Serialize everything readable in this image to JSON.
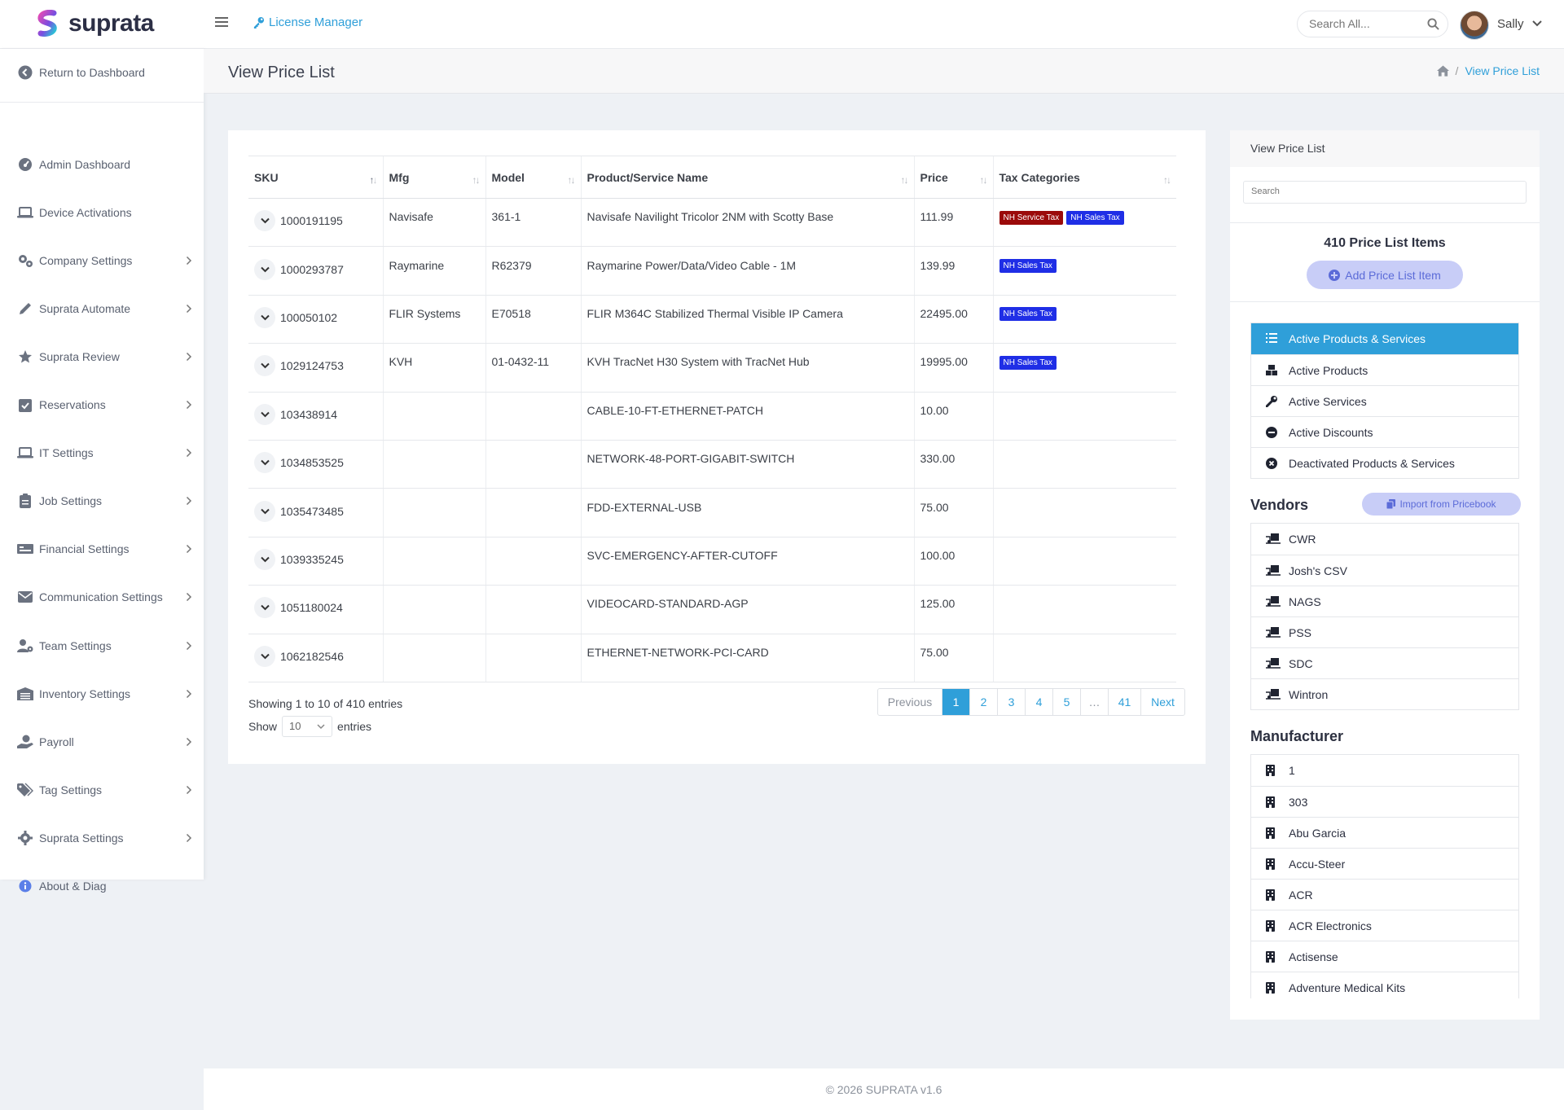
{
  "app": {
    "name": "suprata"
  },
  "topbar": {
    "module_label": "License Manager",
    "search_placeholder": "Search All...",
    "user_name": "Sally"
  },
  "sidebar": {
    "return_label": "Return to Dashboard",
    "items": [
      {
        "label": "Admin Dashboard",
        "icon": "gauge-icon",
        "has_children": false
      },
      {
        "label": "Device Activations",
        "icon": "laptop-icon",
        "has_children": false
      },
      {
        "label": "Company Settings",
        "icon": "gears-icon",
        "has_children": true
      },
      {
        "label": "Suprata Automate",
        "icon": "pencil-icon",
        "has_children": true
      },
      {
        "label": "Suprata Review",
        "icon": "star-icon",
        "has_children": true
      },
      {
        "label": "Reservations",
        "icon": "calendar-check-icon",
        "has_children": true
      },
      {
        "label": "IT Settings",
        "icon": "laptop-icon",
        "has_children": true
      },
      {
        "label": "Job Settings",
        "icon": "clipboard-icon",
        "has_children": true
      },
      {
        "label": "Financial Settings",
        "icon": "money-check-icon",
        "has_children": true
      },
      {
        "label": "Communication Settings",
        "icon": "envelope-icon",
        "has_children": true
      },
      {
        "label": "Team Settings",
        "icon": "user-gear-icon",
        "has_children": true
      },
      {
        "label": "Inventory Settings",
        "icon": "warehouse-icon",
        "has_children": true
      },
      {
        "label": "Payroll",
        "icon": "hand-dollar-icon",
        "has_children": true
      },
      {
        "label": "Tag Settings",
        "icon": "tags-icon",
        "has_children": true
      },
      {
        "label": "Suprata Settings",
        "icon": "gear-icon",
        "has_children": true
      },
      {
        "label": "About & Diag",
        "icon": "info-circle-icon",
        "has_children": false
      }
    ]
  },
  "page": {
    "title": "View Price List",
    "breadcrumb_current": "View Price List"
  },
  "table": {
    "columns": [
      "SKU",
      "Mfg",
      "Model",
      "Product/Service Name",
      "Price",
      "Tax Categories"
    ],
    "rows": [
      {
        "sku": "1000191195",
        "mfg": "Navisafe",
        "model": "361-1",
        "name": "Navisafe Navilight Tricolor 2NM with Scotty Base",
        "price": "111.99",
        "taxes": [
          "NH Service Tax",
          "NH Sales Tax"
        ]
      },
      {
        "sku": "1000293787",
        "mfg": "Raymarine",
        "model": "R62379",
        "name": "Raymarine Power/Data/Video Cable - 1M",
        "price": "139.99",
        "taxes": [
          "NH Sales Tax"
        ]
      },
      {
        "sku": "100050102",
        "mfg": "FLIR Systems",
        "model": "E70518",
        "name": "FLIR M364C Stabilized Thermal Visible IP Camera",
        "price": "22495.00",
        "taxes": [
          "NH Sales Tax"
        ]
      },
      {
        "sku": "1029124753",
        "mfg": "KVH",
        "model": "01-0432-11",
        "name": "KVH TracNet H30 System with TracNet Hub",
        "price": "19995.00",
        "taxes": [
          "NH Sales Tax"
        ]
      },
      {
        "sku": "103438914",
        "mfg": "",
        "model": "",
        "name": "CABLE-10-FT-ETHERNET-PATCH",
        "price": "10.00",
        "taxes": []
      },
      {
        "sku": "1034853525",
        "mfg": "",
        "model": "",
        "name": "NETWORK-48-PORT-GIGABIT-SWITCH",
        "price": "330.00",
        "taxes": []
      },
      {
        "sku": "1035473485",
        "mfg": "",
        "model": "",
        "name": "FDD-EXTERNAL-USB",
        "price": "75.00",
        "taxes": []
      },
      {
        "sku": "1039335245",
        "mfg": "",
        "model": "",
        "name": "SVC-EMERGENCY-AFTER-CUTOFF",
        "price": "100.00",
        "taxes": []
      },
      {
        "sku": "1051180024",
        "mfg": "",
        "model": "",
        "name": "VIDEOCARD-STANDARD-AGP",
        "price": "125.00",
        "taxes": []
      },
      {
        "sku": "1062182546",
        "mfg": "",
        "model": "",
        "name": "ETHERNET-NETWORK-PCI-CARD",
        "price": "75.00",
        "taxes": []
      }
    ],
    "tax_colors": {
      "NH Service Tax": "#9b0a0a",
      "NH Sales Tax": "#1f2ee6"
    },
    "info": "Showing 1 to 10 of 410 entries",
    "show_label": "Show",
    "page_size": "10",
    "entries_label": "entries",
    "pagination": [
      "Previous",
      "1",
      "2",
      "3",
      "4",
      "5",
      "…",
      "41",
      "Next"
    ],
    "current_page": "1"
  },
  "panel": {
    "title": "View Price List",
    "search_placeholder": "Search",
    "count_text": "410 Price List Items",
    "add_button": "Add Price List Item",
    "filters": [
      {
        "label": "Active Products & Services",
        "icon": "list-icon",
        "active": true
      },
      {
        "label": "Active Products",
        "icon": "boxes-icon",
        "active": false
      },
      {
        "label": "Active Services",
        "icon": "wrench-icon",
        "active": false
      },
      {
        "label": "Active Discounts",
        "icon": "minus-circle-icon",
        "active": false
      },
      {
        "label": "Deactivated Products & Services",
        "icon": "x-circle-icon",
        "active": false
      }
    ],
    "vendors_title": "Vendors",
    "import_button": "Import from Pricebook",
    "vendors": [
      "CWR",
      "Josh's CSV",
      "NAGS",
      "PSS",
      "SDC",
      "Wintron"
    ],
    "manufacturer_title": "Manufacturer",
    "manufacturers": [
      "1",
      "303",
      "Abu Garcia",
      "Accu-Steer",
      "ACR",
      "ACR Electronics",
      "Actisense",
      "Adventure Medical Kits"
    ]
  },
  "footer": {
    "text": "© 2026 SUPRATA v1.6"
  },
  "colors": {
    "accent": "#2f9fd9",
    "button_soft": "#c8cdf7",
    "button_soft_text": "#5b6bd8"
  }
}
